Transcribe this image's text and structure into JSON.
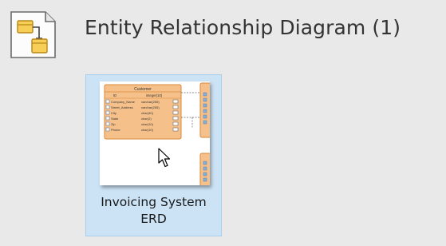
{
  "header": {
    "icon": "erd-diagram-icon",
    "title": "Entity Relationship Diagram (1)"
  },
  "diagrams": [
    {
      "name_line1": "Invoicing System",
      "name_line2": "ERD",
      "thumbnail": {
        "entity_title": "Customer",
        "columns": [
          {
            "name": "ID",
            "type": "integer(10)"
          },
          {
            "name": "Company_Name",
            "type": "varchar(255)"
          },
          {
            "name": "Street_Address",
            "type": "varchar(255)"
          },
          {
            "name": "City",
            "type": "char(40)"
          },
          {
            "name": "State",
            "type": "char(2)"
          },
          {
            "name": "Zip",
            "type": "char(10)"
          },
          {
            "name": "Phone",
            "type": "char(10)"
          }
        ]
      }
    }
  ],
  "colors": {
    "background": "#e9e9e9",
    "tile_selected": "#cce3f6",
    "entity_fill": "#f5c089",
    "entity_border": "#d9893a"
  }
}
